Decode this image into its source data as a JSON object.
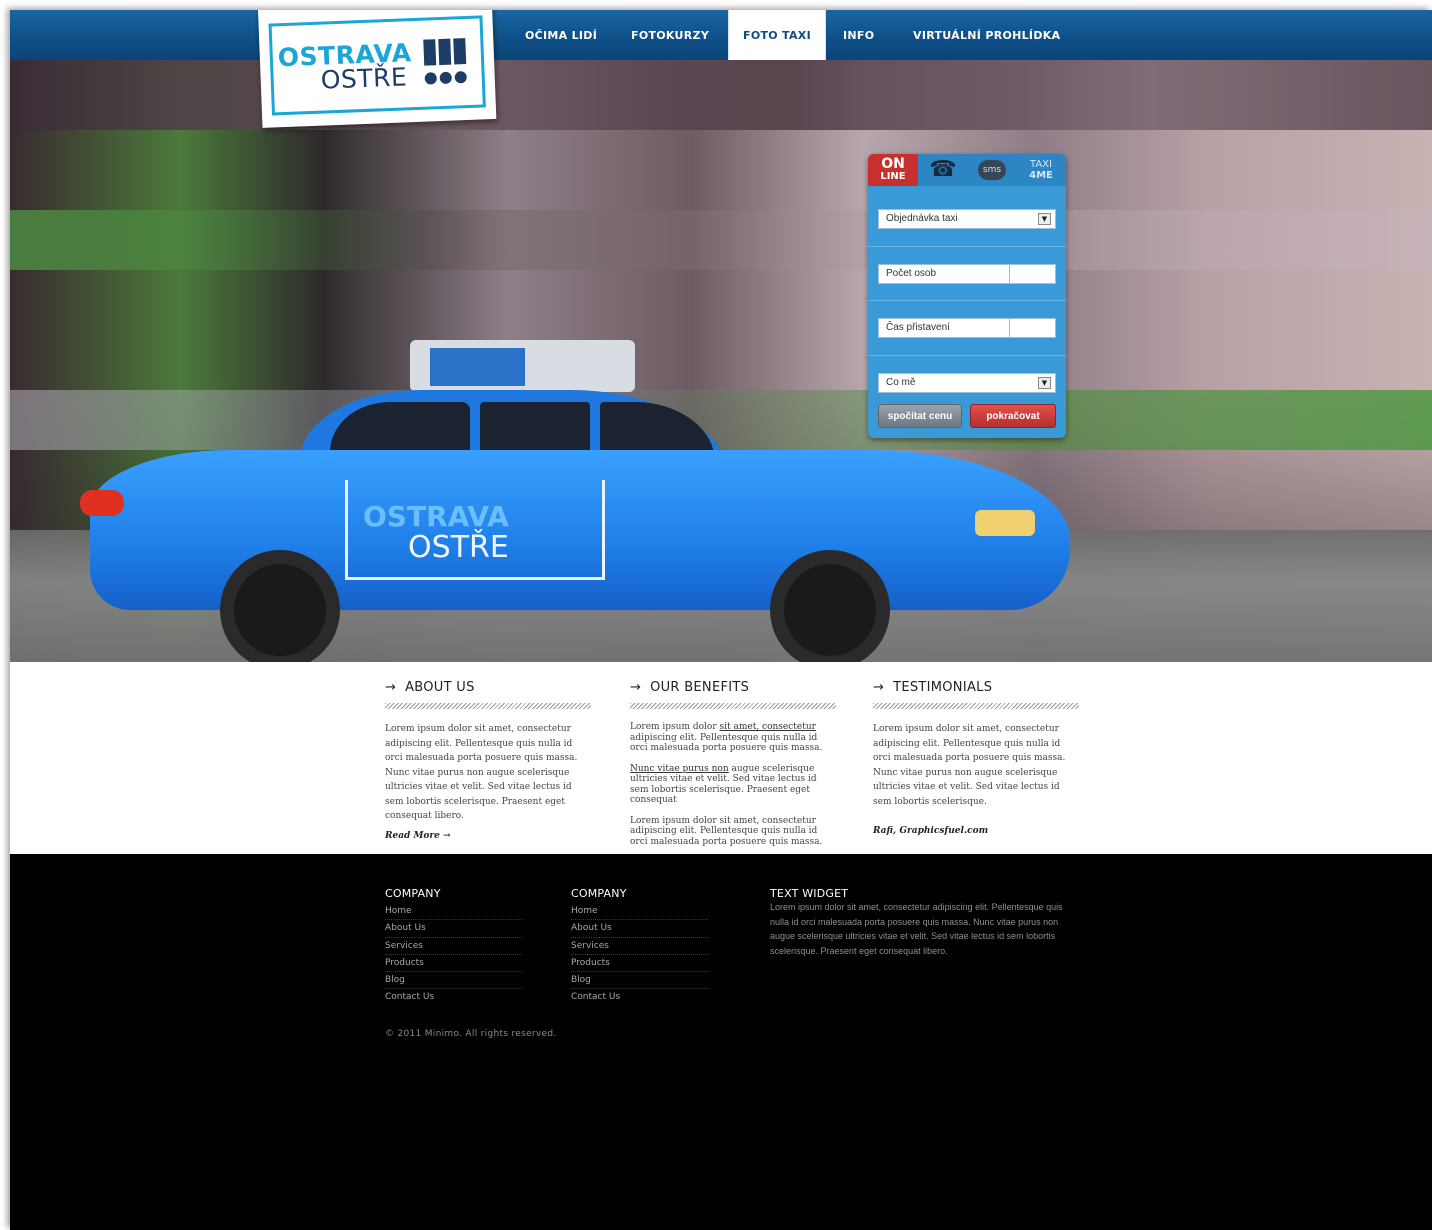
{
  "nav": {
    "items": [
      {
        "label": "OČIMA LIDÍ"
      },
      {
        "label": "FOTOKURZY"
      },
      {
        "label": "FOTO TAXI"
      },
      {
        "label": "INFO"
      },
      {
        "label": "VIRTUÁLNÍ PROHLÍDKA"
      }
    ],
    "active": "FOTO TAXI"
  },
  "logo": {
    "line1": "OSTRAVA",
    "line2": "OSTŘE"
  },
  "booking": {
    "tabs": [
      {
        "line1": "ON",
        "line2": "LINE",
        "icon": "online-badge"
      },
      {
        "icon": "phone-icon",
        "glyph": "☎"
      },
      {
        "label": "sms",
        "icon": "sms-bubble-icon"
      },
      {
        "line1": "TAXI",
        "line2": "4ME"
      }
    ],
    "fields": {
      "order": "Objednávka taxi",
      "persons": "Počet osob",
      "time": "Čas přistavení",
      "what": "Co mě"
    },
    "buttons": {
      "calc": "spočítat cenu",
      "continue": "pokračovat"
    },
    "colors": {
      "panel": "#3a9ad8",
      "active_tab": "#c8302e"
    }
  },
  "content": {
    "about": {
      "heading": "ABOUT US",
      "arrow": "→",
      "text": "Lorem ipsum dolor sit amet, consectetur adipiscing elit. Pellentesque quis nulla id orci malesuada porta posuere quis massa. Nunc vitae purus non augue scelerisque ultricies vitae et velit. Sed vitae lectus id sem lobortis scelerisque. Praesent eget consequat libero.",
      "read_more": "Read More →"
    },
    "benefits": {
      "heading": "OUR BENEFITS",
      "arrow": "→",
      "p1_start": "Lorem ipsum dolor ",
      "p1_link": "sit amet, consectetur",
      "p1_end": " adipiscing elit. Pellentesque quis nulla id orci malesuada porta posuere quis massa.",
      "p2_link": "Nunc vitae purus non",
      "p2_end": " augue scelerisque ultricies vitae et velit. Sed vitae lectus id sem lobortis scelerisque. Praesent eget consequat",
      "p3": "Lorem ipsum dolor sit amet, consectetur adipiscing elit. Pellentesque quis nulla id orci malesuada porta posuere quis massa."
    },
    "testimonials": {
      "heading": "TESTIMONIALS",
      "arrow": "→",
      "text": "Lorem ipsum dolor sit amet, consectetur adipiscing elit. Pellentesque quis nulla id orci malesuada porta posuere quis massa. Nunc vitae purus non augue scelerisque ultricies vitae et velit. Sed vitae lectus id sem lobortis scelerisque.",
      "author": "Rafi, Graphicsfuel.com"
    }
  },
  "footer": {
    "col1": {
      "heading": "COMPANY",
      "links": [
        "Home",
        "About Us",
        "Services",
        "Products",
        "Blog",
        "Contact Us"
      ]
    },
    "col2": {
      "heading": "COMPANY",
      "links": [
        "Home",
        "About Us",
        "Services",
        "Products",
        "Blog",
        "Contact Us"
      ]
    },
    "widget": {
      "heading": "TEXT WIDGET",
      "text": "Lorem ipsum dolor sit amet, consectetur adipiscing elit. Pellentesque quis nulla id orci malesuada porta posuere quis massa. Nunc vitae purus non augue scelerisque ultricies vitae et velit. Sed vitae lectus id sem lobortis scelerisque. Praesent eget consequat libero."
    },
    "copyright": "© 2011 Minimo. All rights reserved."
  }
}
